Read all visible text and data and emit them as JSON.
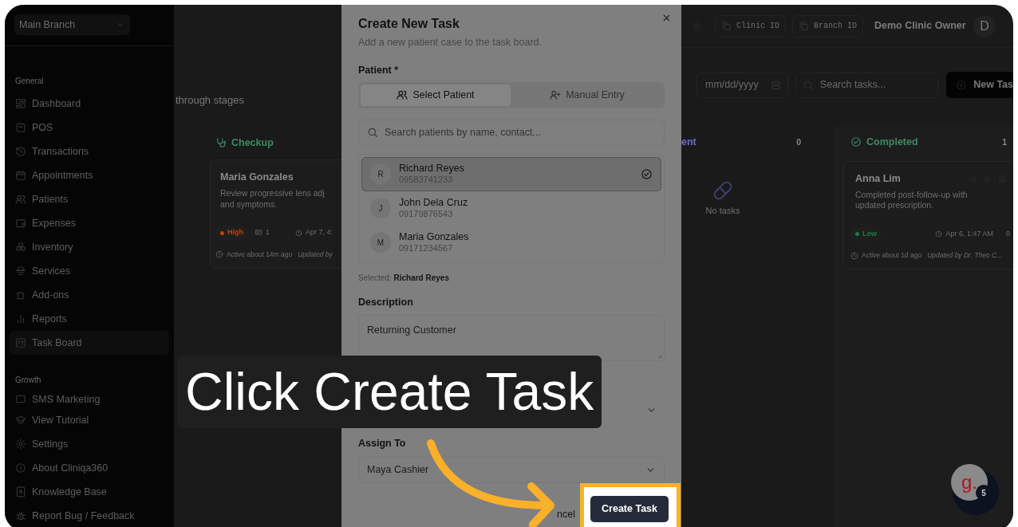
{
  "sidebar": {
    "branch_select": "Main Branch",
    "sections": [
      {
        "heading": "General",
        "items": [
          {
            "label": "Dashboard",
            "selected": false
          },
          {
            "label": "POS",
            "selected": false
          },
          {
            "label": "Transactions",
            "selected": false
          },
          {
            "label": "Appointments",
            "selected": false
          },
          {
            "label": "Patients",
            "selected": false
          },
          {
            "label": "Expenses",
            "selected": false
          },
          {
            "label": "Inventory",
            "selected": false
          },
          {
            "label": "Services",
            "selected": false
          },
          {
            "label": "Add-ons",
            "selected": false
          },
          {
            "label": "Reports",
            "selected": false
          },
          {
            "label": "Task Board",
            "selected": true
          }
        ]
      },
      {
        "heading": "Growth",
        "items": [
          {
            "label": "SMS Marketing",
            "selected": false
          }
        ]
      }
    ],
    "footer_items": [
      {
        "label": "View Tutorial"
      },
      {
        "label": "Settings"
      },
      {
        "label": "About Cliniqa360"
      },
      {
        "label": "Knowledge Base"
      },
      {
        "label": "Report Bug / Feedback"
      }
    ]
  },
  "topbar": {
    "clinic_id": "Clinic ID",
    "branch_id": "Branch ID",
    "user_name": "Demo Clinic Owner",
    "avatar": "D"
  },
  "toolbar": {
    "subtitle": "through stages",
    "date_placeholder": "mm/dd/yyyy",
    "search_placeholder": "Search tasks...",
    "new_task_button": "New Tas"
  },
  "board": {
    "columns": [
      {
        "title": "Checkup",
        "card": {
          "patient": "Maria Gonzales",
          "description_lines": [
            "Review progressive lens adj",
            "and symptoms."
          ],
          "priority": "High",
          "color": "#c2410c",
          "comments": "1",
          "date": "Apr 7, 4:",
          "activity": "Active about 14m ago",
          "updated": "Updated by"
        }
      },
      {
        "title": "ent",
        "count": "0",
        "empty_text": "No tasks"
      },
      {
        "title": "Completed",
        "count": "1",
        "card": {
          "patient": "Anna Lim",
          "description_lines": [
            "Completed post-follow-up with",
            "updated prescription."
          ],
          "priority": "Low",
          "color": "#15803d",
          "comments": "0",
          "date": "Apr 6, 1:47 AM",
          "activity": "Active about 1d ago",
          "updated": "Updated by Dr. Theo C..."
        }
      }
    ]
  },
  "modal": {
    "title": "Create New Task",
    "subtitle": "Add a new patient case to the task board.",
    "patient_label": "Patient *",
    "tabs": [
      {
        "label": "Select Patient",
        "selected": true
      },
      {
        "label": "Manual Entry",
        "selected": false
      }
    ],
    "search_placeholder": "Search patients by name, contact...",
    "patients": [
      {
        "initial": "R",
        "name": "Richard Reyes",
        "phone": "09583741233",
        "selected": true
      },
      {
        "initial": "J",
        "name": "John Dela Cruz",
        "phone": "09179876543",
        "selected": false
      },
      {
        "initial": "M",
        "name": "Maria Gonzales",
        "phone": "09171234567",
        "selected": false
      }
    ],
    "selected_text": "Selected: **Richard Reyes**",
    "description_label": "Description",
    "description_value": "Returning Customer",
    "assign_label": "Assign To",
    "assign_value": "Maya Cashier",
    "cancel_button": "ncel",
    "submit_button": "Create Task"
  },
  "tutorial": {
    "caption": "Click Create Task"
  },
  "help_widget": {
    "logo": "g.",
    "badge": "5"
  }
}
